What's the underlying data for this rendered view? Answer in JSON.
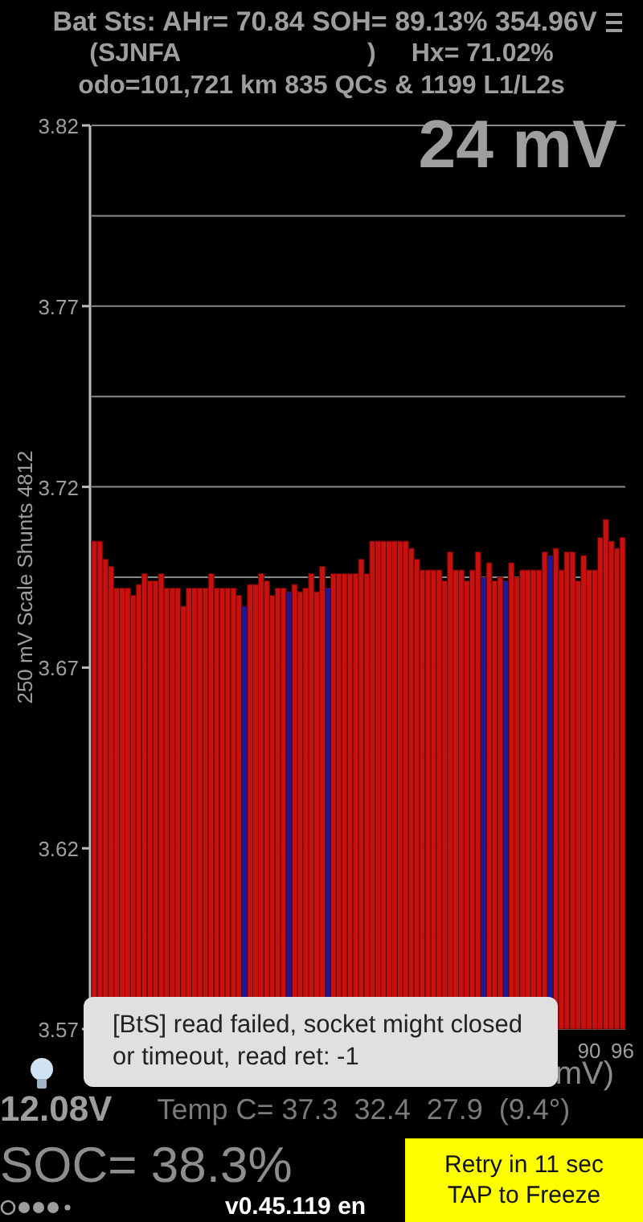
{
  "header": {
    "status_line": "Bat Sts: AHr= 70.84 SOH= 89.13% 354.96V",
    "vin_start": "(SJNFA",
    "vin_end": ")",
    "hx": "Hx= 71.02%",
    "odo_line": "odo=101,721 km 835 QCs & 1199 L1/L2s"
  },
  "chart": {
    "spread": "24 mV",
    "minmax": "mV)",
    "temperature": "Temp C= 37.3  32.4  27.9  (9.4°)",
    "chart_data": {
      "type": "bar",
      "ylabel": "250 mV Scale   Shunts 4812",
      "ylim": [
        3.57,
        3.82
      ],
      "yticks": [
        3.57,
        3.62,
        3.67,
        3.72,
        3.77,
        3.82
      ],
      "xlim": [
        0.5,
        96.5
      ],
      "xticks": [
        90,
        96
      ],
      "x": [
        1,
        2,
        3,
        4,
        5,
        6,
        7,
        8,
        9,
        10,
        11,
        12,
        13,
        14,
        15,
        16,
        17,
        18,
        19,
        20,
        21,
        22,
        23,
        24,
        25,
        26,
        27,
        28,
        29,
        30,
        31,
        32,
        33,
        34,
        35,
        36,
        37,
        38,
        39,
        40,
        41,
        42,
        43,
        44,
        45,
        46,
        47,
        48,
        49,
        50,
        51,
        52,
        53,
        54,
        55,
        56,
        57,
        58,
        59,
        60,
        61,
        62,
        63,
        64,
        65,
        66,
        67,
        68,
        69,
        70,
        71,
        72,
        73,
        74,
        75,
        76,
        77,
        78,
        79,
        80,
        81,
        82,
        83,
        84,
        85,
        86,
        87,
        88,
        89,
        90,
        91,
        92,
        93,
        94,
        95,
        96
      ],
      "series": [
        {
          "color": "#c8100f",
          "values": [
            3.705,
            3.705,
            3.7,
            3.698,
            3.692,
            3.692,
            3.692,
            3.69,
            3.693,
            3.696,
            3.694,
            3.694,
            3.696,
            3.692,
            3.692,
            3.692,
            3.687,
            3.692,
            3.692,
            3.692,
            3.692,
            3.696,
            3.692,
            3.692,
            3.692,
            3.692,
            3.69,
            null,
            3.693,
            3.693,
            3.696,
            3.694,
            3.69,
            3.692,
            3.692,
            null,
            3.693,
            3.691,
            3.692,
            3.696,
            3.691,
            3.698,
            null,
            3.696,
            3.696,
            3.696,
            3.696,
            3.696,
            3.7,
            3.696,
            3.705,
            3.705,
            3.705,
            3.705,
            3.705,
            3.705,
            3.705,
            3.703,
            3.7,
            3.697,
            3.697,
            3.697,
            3.697,
            3.694,
            3.702,
            3.697,
            3.697,
            3.694,
            3.697,
            3.702,
            null,
            3.699,
            3.694,
            3.695,
            null,
            3.699,
            3.695,
            3.697,
            3.697,
            3.697,
            3.697,
            3.702,
            null,
            3.703,
            3.697,
            3.702,
            3.702,
            3.694,
            3.701,
            3.697,
            3.697,
            3.706,
            3.711,
            3.705,
            3.703,
            3.706
          ]
        },
        {
          "color": "#1c1a9a",
          "values": [
            null,
            null,
            null,
            null,
            null,
            null,
            null,
            null,
            null,
            null,
            null,
            null,
            null,
            null,
            null,
            null,
            null,
            null,
            null,
            null,
            null,
            null,
            null,
            null,
            null,
            null,
            null,
            3.687,
            null,
            null,
            null,
            null,
            null,
            null,
            null,
            3.691,
            null,
            null,
            null,
            null,
            null,
            null,
            3.692,
            null,
            null,
            null,
            null,
            null,
            null,
            null,
            null,
            null,
            null,
            null,
            null,
            null,
            null,
            null,
            null,
            null,
            null,
            null,
            null,
            null,
            null,
            null,
            null,
            null,
            null,
            null,
            3.695,
            null,
            null,
            null,
            3.694,
            null,
            null,
            null,
            null,
            null,
            null,
            null,
            3.701,
            null,
            null,
            null,
            null,
            null,
            null,
            null,
            null,
            null,
            null,
            null,
            null,
            null
          ]
        }
      ]
    }
  },
  "toast": {
    "message": "[BtS] read failed, socket might closed or timeout, read ret: -1"
  },
  "footer": {
    "aux_voltage": "12.08V",
    "soc": "SOC= 38.3%",
    "version": "v0.45.119 en",
    "retry_button": {
      "lines": [
        "Retry in 11 sec",
        "TAP to Freeze"
      ]
    }
  }
}
